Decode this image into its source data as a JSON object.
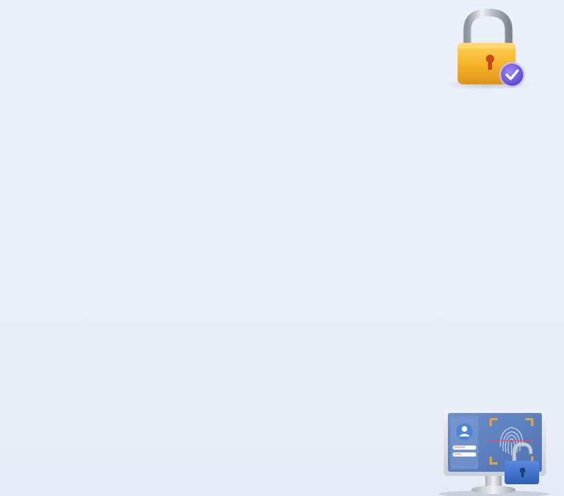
{
  "illustrations": {
    "padlock": {
      "icon": "padlock-with-checkmark",
      "colors": {
        "body": "#f5b52a",
        "shackle": "#b9c0c8",
        "badge": "#7b62e8",
        "keyhole": "#d2572a"
      }
    },
    "monitor": {
      "icon": "monitor-fingerprint-login",
      "password_mask_1": "*****",
      "password_mask_2": "***",
      "colors": {
        "screen": "#5a7fbd",
        "frame": "#d8dde3",
        "scan_corners": "#f0a828",
        "lock": "#3f6fc4"
      }
    }
  },
  "background_color": "#e9eef8"
}
